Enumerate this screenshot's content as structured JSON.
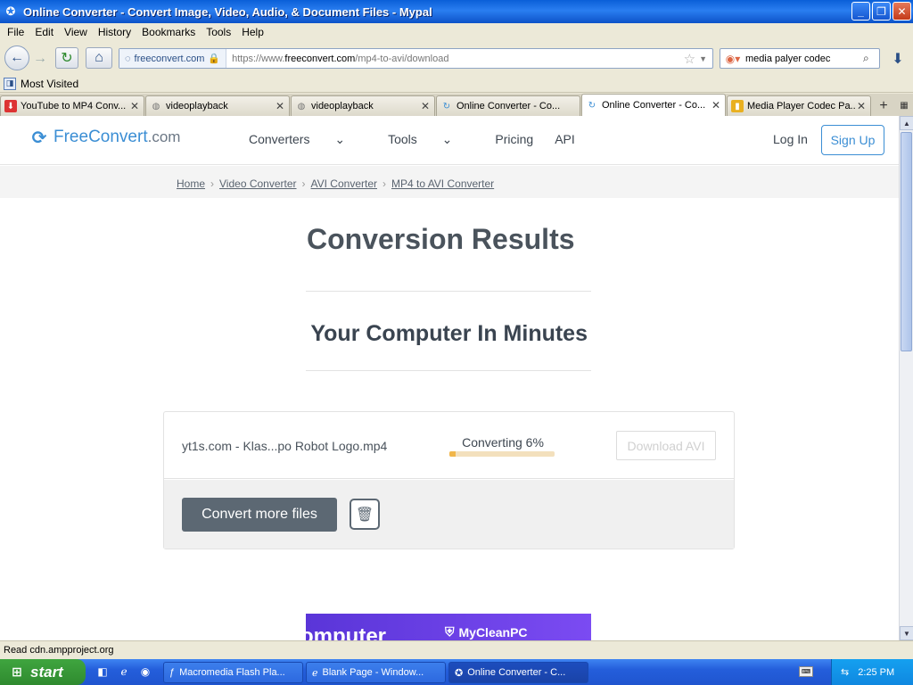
{
  "window": {
    "title": "Online Converter - Convert Image, Video, Audio, & Document Files - Mypal"
  },
  "menu": [
    "File",
    "Edit",
    "View",
    "History",
    "Bookmarks",
    "Tools",
    "Help"
  ],
  "nav": {
    "site_label": "freeconvert.com",
    "url_prefix": "https://www.",
    "url_domain": "freeconvert.com",
    "url_path": "/mp4-to-avi/download",
    "search_value": "media palyer codec"
  },
  "bookmarks": {
    "most_visited": "Most Visited"
  },
  "tabs": [
    {
      "label": "YouTube to MP4 Conv...",
      "active": false
    },
    {
      "label": "videoplayback",
      "active": false
    },
    {
      "label": "videoplayback",
      "active": false
    },
    {
      "label": "Online Converter - Co...",
      "active": false
    },
    {
      "label": "Online Converter - Co...",
      "active": true
    },
    {
      "label": "Media Player Codec Pa...",
      "active": false
    }
  ],
  "site": {
    "logo_main": "FreeConvert",
    "logo_suffix": ".com",
    "nav": [
      "Converters",
      "Tools",
      "Pricing",
      "API"
    ],
    "login": "Log In",
    "signup": "Sign Up"
  },
  "breadcrumb": [
    "Home",
    "Video Converter",
    "AVI Converter",
    "MP4 to AVI Converter"
  ],
  "heading": "Conversion Results",
  "subheading": "Your Computer In Minutes",
  "conversion": {
    "file_name": "yt1s.com - Klas...po Robot Logo.mp4",
    "status": "Converting 6%",
    "progress_percent": 6,
    "download_label": "Download AVI",
    "convert_more_label": "Convert more files"
  },
  "ad": {
    "text": "omputer",
    "brand": "MyCleanPC"
  },
  "statusbar": "Read cdn.ampproject.org",
  "taskbar": {
    "start": "start",
    "tasks": [
      {
        "label": "Macromedia Flash Pla...",
        "active": false
      },
      {
        "label": "Blank Page - Window...",
        "active": false
      },
      {
        "label": "Online Converter - C...",
        "active": true
      }
    ],
    "clock": "2:25 PM"
  }
}
